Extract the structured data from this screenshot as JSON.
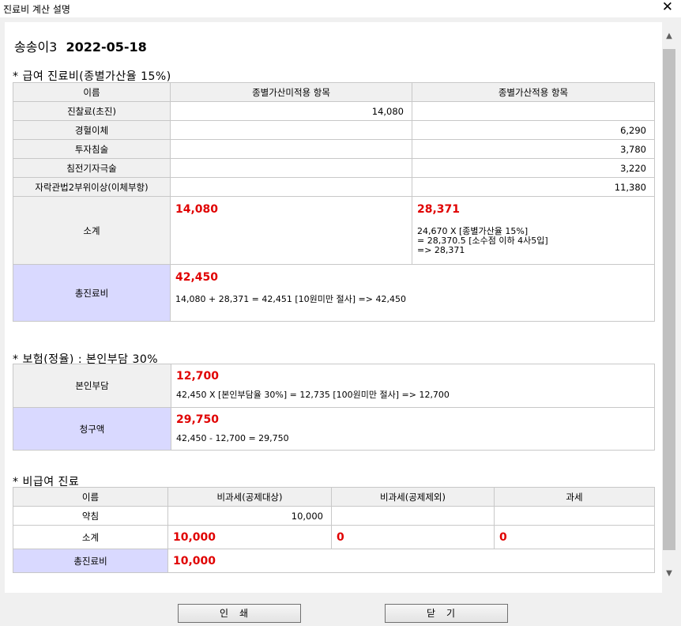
{
  "window": {
    "title": "진료비 계산 설명",
    "close": "✕"
  },
  "header": {
    "patient": "송송이3",
    "date": "2022-05-18"
  },
  "section1": {
    "title": "* 급여 진료비(종별가산율 15%)",
    "columns": [
      "이름",
      "종별가산미적용 항목",
      "종별가산적용 항목"
    ],
    "rows": [
      {
        "name": "진찰료(초진)",
        "no": "14,080",
        "yes": ""
      },
      {
        "name": "경혈이체",
        "no": "",
        "yes": "6,290"
      },
      {
        "name": "투자침술",
        "no": "",
        "yes": "3,780"
      },
      {
        "name": "침전기자극술",
        "no": "",
        "yes": "3,220"
      },
      {
        "name": "자락관법2부위이상(이체부항)",
        "no": "",
        "yes": "11,380"
      }
    ],
    "subtotal": {
      "label": "소계",
      "no_value": "14,080",
      "yes_value": "28,371",
      "note1": "24,670 X [종별가산율 15%]",
      "note2": "=  28,370.5 [소수점 이하 4사5입]",
      "note3": "=> 28,371"
    },
    "total": {
      "label": "총진료비",
      "value": "42,450",
      "note": "14,080 + 28,371 =  42,451 [10원미만 절사] =>   42,450"
    }
  },
  "section2": {
    "title": "* 보험(정율) : 본인부담 30%",
    "copay": {
      "label": "본인부담",
      "value": "12,700",
      "note": "42,450 X [본인부담율 30%] = 12,735 [100원미만 절사] => 12,700"
    },
    "claim": {
      "label": "청구액",
      "value": "29,750",
      "note": "42,450 - 12,700 = 29,750"
    }
  },
  "section3": {
    "title": "* 비급여 진료",
    "columns": [
      "이름",
      "비과세(공제대상)",
      "비과세(공제제외)",
      "과세"
    ],
    "rows": [
      {
        "name": "약침",
        "a": "10,000",
        "b": "",
        "c": ""
      }
    ],
    "subtotal": {
      "label": "소계",
      "a": "10,000",
      "b": "0",
      "c": "0"
    },
    "total": {
      "label": "총진료비",
      "value": "10,000"
    }
  },
  "buttons": {
    "print": "인쇄",
    "close": "닫기"
  }
}
